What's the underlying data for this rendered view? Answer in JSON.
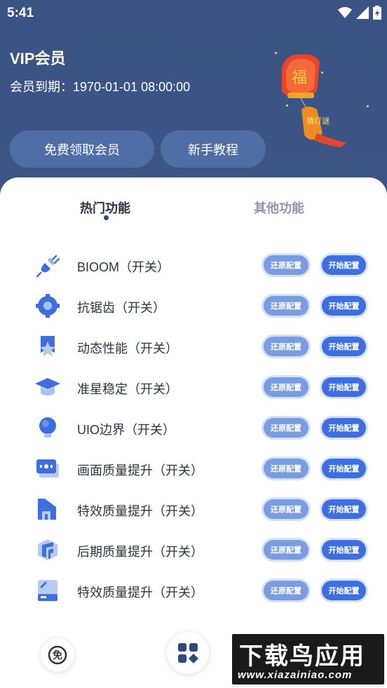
{
  "status_bar": {
    "time": "5:41",
    "wifi_icon": "wifi-icon",
    "signal_icon": "signal-icon",
    "battery_icon": "battery-charging-icon"
  },
  "header": {
    "title": "VIP会员",
    "expire_label": "会员到期：",
    "expire_value": "1970-01-01 08:00:00",
    "free_vip_button": "免费领取会员",
    "tutorial_button": "新手教程",
    "lantern_chars": [
      "福",
      "猜灯谜"
    ]
  },
  "tabs": [
    {
      "label": "热门功能",
      "active": true
    },
    {
      "label": "其他功能",
      "active": false
    }
  ],
  "restore_label": "还原配置",
  "start_label": "开始配置",
  "features": [
    {
      "label": "BIOOM（开关）",
      "icon": "plug-icon"
    },
    {
      "label": "抗锯齿（开关）",
      "icon": "gear-icon"
    },
    {
      "label": "动态性能（开关）",
      "icon": "bookmark-star-icon"
    },
    {
      "label": "准星稳定（开关）",
      "icon": "graduation-cap-icon"
    },
    {
      "label": "UIO边界（开关）",
      "icon": "bulb-icon"
    },
    {
      "label": "画面质量提升（开关）",
      "icon": "screen-icon"
    },
    {
      "label": "特效质量提升（开关）",
      "icon": "building-icon"
    },
    {
      "label": "后期质量提升（开关）",
      "icon": "cube-icon"
    },
    {
      "label": "特效质量提升（开关）",
      "icon": "card-icon"
    }
  ],
  "bottom_nav": {
    "free_icon_char": "免",
    "grid_icon": "apps-grid-icon"
  },
  "watermark": {
    "top": "下载鸟应用",
    "bottom": "www.xiazainiao.com"
  },
  "colors": {
    "header_bg": "#3a5384",
    "accent": "#3d6fe0",
    "restore": "#7a9ce0"
  }
}
